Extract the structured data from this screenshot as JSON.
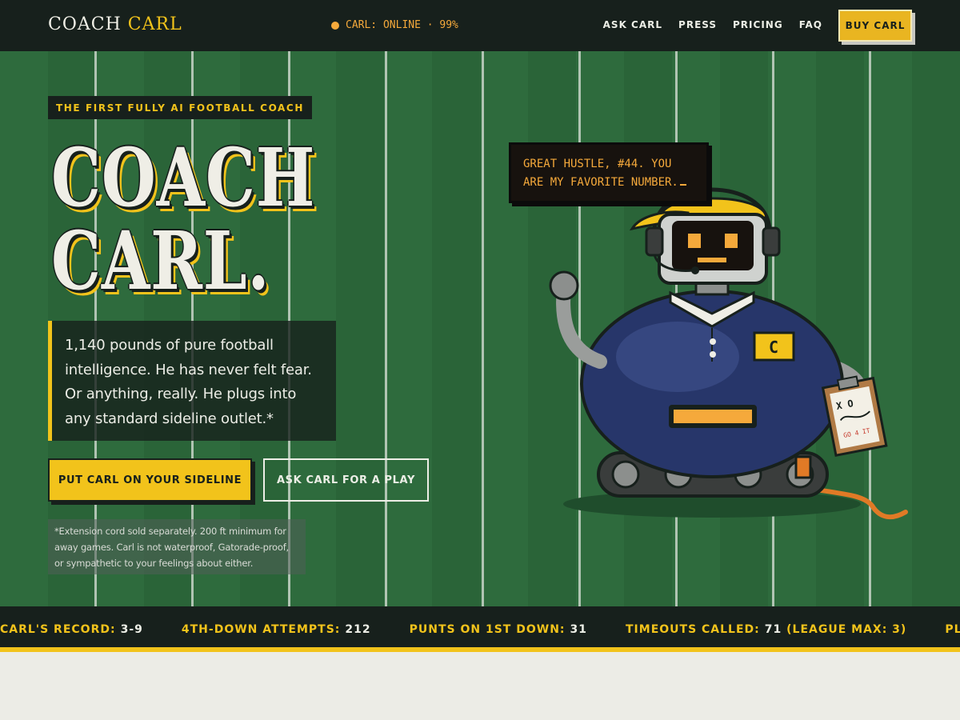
{
  "nav": {
    "logo_main": "COACH",
    "logo_accent": "CARL",
    "status": "CARL: ONLINE · 99%",
    "links": [
      "ASK CARL",
      "PRESS",
      "PRICING",
      "FAQ"
    ],
    "buy_label": "BUY CARL"
  },
  "hero": {
    "eyebrow": "THE FIRST FULLY AI FOOTBALL COACH",
    "headline_line1": "COACH",
    "headline_line2": "CARL.",
    "lede": "1,140 pounds of pure football intelligence. He has never felt fear. Or anything, really. He plugs into any standard sideline outlet.*",
    "cta_primary": "PUT CARL ON YOUR SIDELINE",
    "cta_secondary": "ASK CARL FOR A PLAY",
    "fineprint": "*Extension cord sold separately. 200 ft minimum for away games. Carl is not waterproof, Gatorade-proof, or sympathetic to your feelings about either."
  },
  "speech": {
    "text": "GREAT HUSTLE, #44. YOU ARE MY FAVORITE NUMBER."
  },
  "robot": {
    "chest_badge": "C",
    "clipboard_marks": "X O",
    "clipboard_note": "GO 4 IT"
  },
  "ticker": [
    {
      "label": "CARL'S RECORD:",
      "value": "3-9"
    },
    {
      "label": "4TH-DOWN ATTEMPTS:",
      "value": "212"
    },
    {
      "label": "PUNTS ON 1ST DOWN:",
      "value": "31"
    },
    {
      "label": "TIMEOUTS CALLED:",
      "value": "71",
      "suffix": "(LEAGUE MAX: 3)"
    },
    {
      "label": "PLAYERS ADDRESS",
      "value": ""
    }
  ],
  "colors": {
    "accent": "#f2c31b",
    "dark": "#17201c",
    "field": "#2e6b3d",
    "terminal_orange": "#f5a93b",
    "jersey_navy": "#27366a"
  }
}
